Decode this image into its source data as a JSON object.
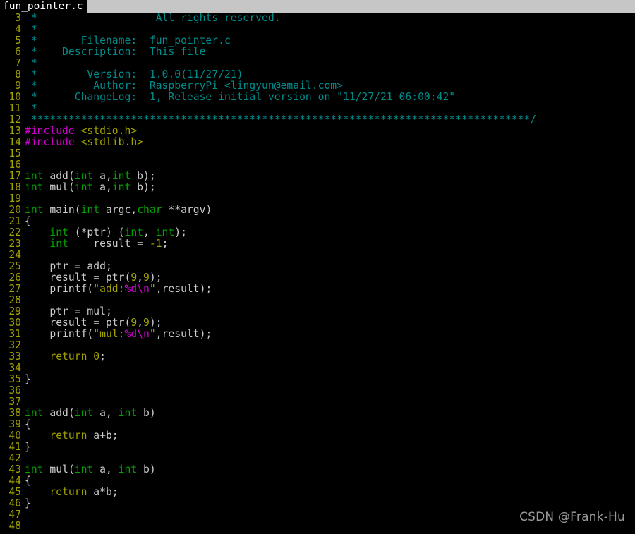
{
  "window": {
    "title": "fun_pointer.c",
    "background_color": "#000000"
  },
  "tabbar": {
    "background_color": "#c6c6c6",
    "tabs": [
      {
        "label": "fun_pointer.c",
        "active": true
      }
    ]
  },
  "colors": {
    "background": "#000000",
    "line_number": "#a2a200",
    "plain_text": "#cccccc",
    "comment": "#008b8b",
    "preprocessor": "#cd00cd",
    "string": "#a2a200",
    "special_char": "#cd00cd",
    "type_keyword": "#00a400",
    "statement_keyword": "#a2a200",
    "number": "#a2a200",
    "tab_active_bg": "#000000",
    "tab_active_fg": "#ffffff",
    "tabbar_bg": "#c6c6c6",
    "watermark": "#9a9a9a"
  },
  "editor": {
    "first_visible_line": 3,
    "last_visible_line": 48,
    "language": "c",
    "filename": "fun_pointer.c",
    "lines": [
      {
        "n": "3",
        "tokens": [
          {
            "c": "comment",
            "t": " *                   All rights reserved."
          }
        ]
      },
      {
        "n": "4",
        "tokens": [
          {
            "c": "comment",
            "t": " *"
          }
        ]
      },
      {
        "n": "5",
        "tokens": [
          {
            "c": "comment",
            "t": " *       Filename:  fun_pointer.c"
          }
        ]
      },
      {
        "n": "6",
        "tokens": [
          {
            "c": "comment",
            "t": " *    Description:  This file"
          }
        ]
      },
      {
        "n": "7",
        "tokens": [
          {
            "c": "comment",
            "t": " *"
          }
        ]
      },
      {
        "n": "8",
        "tokens": [
          {
            "c": "comment",
            "t": " *        Version:  1.0.0(11/27/21)"
          }
        ]
      },
      {
        "n": "9",
        "tokens": [
          {
            "c": "comment",
            "t": " *         Author:  RaspberryPi <lingyun@email.com>"
          }
        ]
      },
      {
        "n": "10",
        "tokens": [
          {
            "c": "comment",
            "t": " *      ChangeLog:  1, Release initial version on \"11/27/21 06:00:42\""
          }
        ]
      },
      {
        "n": "11",
        "tokens": [
          {
            "c": "comment",
            "t": " *"
          }
        ]
      },
      {
        "n": "12",
        "tokens": [
          {
            "c": "comment",
            "t": " ********************************************************************************/"
          }
        ]
      },
      {
        "n": "13",
        "tokens": [
          {
            "c": "pre",
            "t": "#include"
          },
          {
            "c": "plain",
            "t": " "
          },
          {
            "c": "string",
            "t": "<stdio.h>"
          }
        ]
      },
      {
        "n": "14",
        "tokens": [
          {
            "c": "pre",
            "t": "#include"
          },
          {
            "c": "plain",
            "t": " "
          },
          {
            "c": "string",
            "t": "<stdlib.h>"
          }
        ]
      },
      {
        "n": "15",
        "tokens": []
      },
      {
        "n": "16",
        "tokens": []
      },
      {
        "n": "17",
        "tokens": [
          {
            "c": "type",
            "t": "int"
          },
          {
            "c": "plain",
            "t": " add("
          },
          {
            "c": "type",
            "t": "int"
          },
          {
            "c": "plain",
            "t": " a,"
          },
          {
            "c": "type",
            "t": "int"
          },
          {
            "c": "plain",
            "t": " b);"
          }
        ]
      },
      {
        "n": "18",
        "tokens": [
          {
            "c": "type",
            "t": "int"
          },
          {
            "c": "plain",
            "t": " mul("
          },
          {
            "c": "type",
            "t": "int"
          },
          {
            "c": "plain",
            "t": " a,"
          },
          {
            "c": "type",
            "t": "int"
          },
          {
            "c": "plain",
            "t": " b);"
          }
        ]
      },
      {
        "n": "19",
        "tokens": []
      },
      {
        "n": "20",
        "tokens": [
          {
            "c": "type",
            "t": "int"
          },
          {
            "c": "plain",
            "t": " main("
          },
          {
            "c": "type",
            "t": "int"
          },
          {
            "c": "plain",
            "t": " argc,"
          },
          {
            "c": "type",
            "t": "char"
          },
          {
            "c": "plain",
            "t": " **argv)"
          }
        ]
      },
      {
        "n": "21",
        "tokens": [
          {
            "c": "plain",
            "t": "{"
          }
        ]
      },
      {
        "n": "22",
        "tokens": [
          {
            "c": "plain",
            "t": "    "
          },
          {
            "c": "type",
            "t": "int"
          },
          {
            "c": "plain",
            "t": " (*ptr) ("
          },
          {
            "c": "type",
            "t": "int"
          },
          {
            "c": "plain",
            "t": ", "
          },
          {
            "c": "type",
            "t": "int"
          },
          {
            "c": "plain",
            "t": ");"
          }
        ]
      },
      {
        "n": "23",
        "tokens": [
          {
            "c": "plain",
            "t": "    "
          },
          {
            "c": "type",
            "t": "int"
          },
          {
            "c": "plain",
            "t": "    result = "
          },
          {
            "c": "number",
            "t": "-1"
          },
          {
            "c": "plain",
            "t": ";"
          }
        ]
      },
      {
        "n": "24",
        "tokens": []
      },
      {
        "n": "25",
        "tokens": [
          {
            "c": "plain",
            "t": "    ptr = add;"
          }
        ]
      },
      {
        "n": "26",
        "tokens": [
          {
            "c": "plain",
            "t": "    result = ptr("
          },
          {
            "c": "number",
            "t": "9"
          },
          {
            "c": "plain",
            "t": ","
          },
          {
            "c": "number",
            "t": "9"
          },
          {
            "c": "plain",
            "t": ");"
          }
        ]
      },
      {
        "n": "27",
        "tokens": [
          {
            "c": "plain",
            "t": "    printf("
          },
          {
            "c": "string",
            "t": "\"add:"
          },
          {
            "c": "special",
            "t": "%d\\n"
          },
          {
            "c": "string",
            "t": "\""
          },
          {
            "c": "plain",
            "t": ",result);"
          }
        ]
      },
      {
        "n": "28",
        "tokens": []
      },
      {
        "n": "29",
        "tokens": [
          {
            "c": "plain",
            "t": "    ptr = mul;"
          }
        ]
      },
      {
        "n": "30",
        "tokens": [
          {
            "c": "plain",
            "t": "    result = ptr("
          },
          {
            "c": "number",
            "t": "9"
          },
          {
            "c": "plain",
            "t": ","
          },
          {
            "c": "number",
            "t": "9"
          },
          {
            "c": "plain",
            "t": ");"
          }
        ]
      },
      {
        "n": "31",
        "tokens": [
          {
            "c": "plain",
            "t": "    printf("
          },
          {
            "c": "string",
            "t": "\"mul:"
          },
          {
            "c": "special",
            "t": "%d\\n"
          },
          {
            "c": "string",
            "t": "\""
          },
          {
            "c": "plain",
            "t": ",result);"
          }
        ]
      },
      {
        "n": "32",
        "tokens": []
      },
      {
        "n": "33",
        "tokens": [
          {
            "c": "plain",
            "t": "    "
          },
          {
            "c": "stmt",
            "t": "return"
          },
          {
            "c": "plain",
            "t": " "
          },
          {
            "c": "number",
            "t": "0"
          },
          {
            "c": "plain",
            "t": ";"
          }
        ]
      },
      {
        "n": "34",
        "tokens": []
      },
      {
        "n": "35",
        "tokens": [
          {
            "c": "plain",
            "t": "}"
          }
        ]
      },
      {
        "n": "36",
        "tokens": []
      },
      {
        "n": "37",
        "tokens": []
      },
      {
        "n": "38",
        "tokens": [
          {
            "c": "type",
            "t": "int"
          },
          {
            "c": "plain",
            "t": " add("
          },
          {
            "c": "type",
            "t": "int"
          },
          {
            "c": "plain",
            "t": " a, "
          },
          {
            "c": "type",
            "t": "int"
          },
          {
            "c": "plain",
            "t": " b)"
          }
        ]
      },
      {
        "n": "39",
        "tokens": [
          {
            "c": "plain",
            "t": "{"
          }
        ]
      },
      {
        "n": "40",
        "tokens": [
          {
            "c": "plain",
            "t": "    "
          },
          {
            "c": "stmt",
            "t": "return"
          },
          {
            "c": "plain",
            "t": " a+b;"
          }
        ]
      },
      {
        "n": "41",
        "tokens": [
          {
            "c": "plain",
            "t": "}"
          }
        ]
      },
      {
        "n": "42",
        "tokens": []
      },
      {
        "n": "43",
        "tokens": [
          {
            "c": "type",
            "t": "int"
          },
          {
            "c": "plain",
            "t": " mul("
          },
          {
            "c": "type",
            "t": "int"
          },
          {
            "c": "plain",
            "t": " a, "
          },
          {
            "c": "type",
            "t": "int"
          },
          {
            "c": "plain",
            "t": " b)"
          }
        ]
      },
      {
        "n": "44",
        "tokens": [
          {
            "c": "plain",
            "t": "{"
          }
        ]
      },
      {
        "n": "45",
        "tokens": [
          {
            "c": "plain",
            "t": "    "
          },
          {
            "c": "stmt",
            "t": "return"
          },
          {
            "c": "plain",
            "t": " a*b;"
          }
        ]
      },
      {
        "n": "46",
        "tokens": [
          {
            "c": "plain",
            "t": "}"
          }
        ]
      },
      {
        "n": "47",
        "tokens": []
      },
      {
        "n": "48",
        "tokens": []
      }
    ]
  },
  "watermark": {
    "text": "CSDN @Frank-Hu"
  }
}
